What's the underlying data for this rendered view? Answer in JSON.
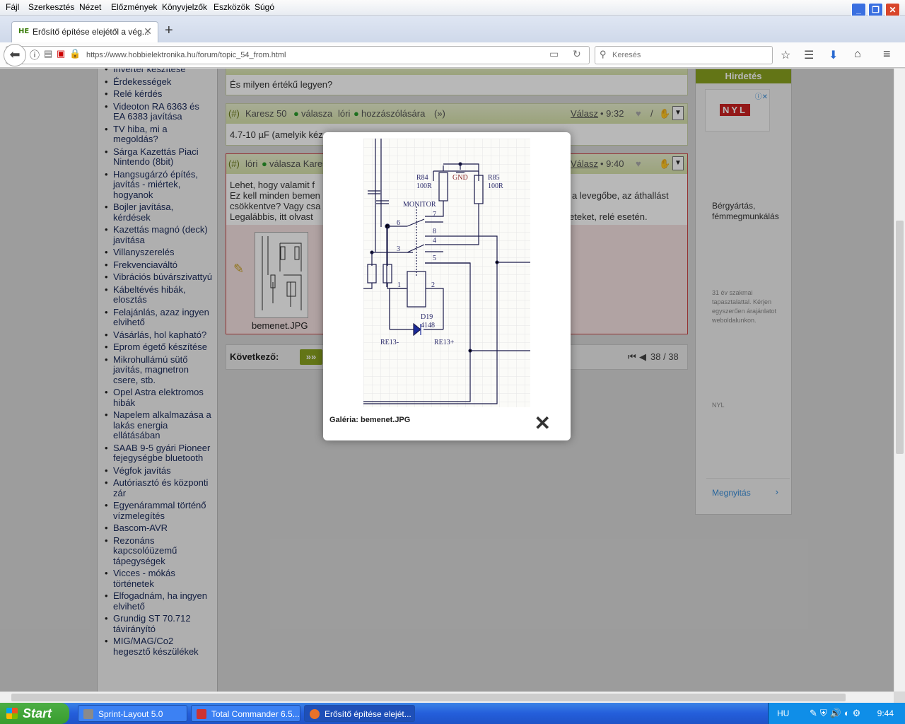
{
  "menu": [
    "Fájl",
    "Szerkesztés",
    "Nézet",
    "Előzmények",
    "Könyvjelzők",
    "Eszközök",
    "Súgó"
  ],
  "tab": {
    "favicon": "HE",
    "title": "Erősítő építése elejétől a vég...",
    "close": "✕",
    "new": "+"
  },
  "nav": {
    "url": "https://www.hobbielektronika.hu/forum/topic_54_from.html",
    "search_placeholder": "Keresés"
  },
  "sidebar": {
    "items": [
      "Inverter készítése",
      "Érdekességek",
      "Relé kérdés",
      "Videoton RA 6363 és EA 6383 javítása",
      "TV hiba, mi a megoldás?",
      "Sárga Kazettás Piaci Nintendo (8bit)",
      "Hangsugárzó építés, javítás - miértek, hogyanok",
      "Bojler javítása, kérdések",
      "Kazettás magnó (deck) javítása",
      "Villanyszerelés",
      "Frekvenciaváltó",
      "Vibrációs búvárszivattyú",
      "Kábeltévés hibák, elosztás",
      "Felajánlás, azaz ingyen elvihető",
      "Vásárlás, hol kapható?",
      "Eprom égető készítése",
      "Mikrohullámú sütő javítás, magnetron csere, stb.",
      "Opel Astra elektromos hibák",
      "Napelem alkalmazása a lakás energia ellátásában",
      "SAAB 9-5 gyári Pioneer fejegységbe bluetooth",
      "Végfok javítás",
      "Autóriasztó és központi zár",
      "Egyenárammal történő vízmelegítés",
      "Bascom-AVR",
      "Rezonáns kapcsolóüzemű tápegységek",
      "Vicces - mókás történetek",
      "Elfogadnám, ha ingyen elvihető",
      "Grundig ST 70.712 távirányító",
      "MIG/MAG/Co2 hegesztő készülékek"
    ]
  },
  "posts": {
    "p1_body": "És milyen értékű legyen?",
    "p2": {
      "hash": "(#)",
      "author": "Karesz 50",
      "reply_to": "válasza",
      "target": "lóri",
      "suffix": "hozzászólására",
      "link": "(»)",
      "reply": "Válasz",
      "time": "• 9:32",
      "sep": "/",
      "body": "4.7-10 µF (amelyik kéz"
    },
    "p3": {
      "hash": "(#)",
      "author": "lóri",
      "reply_to": "válasza Karesz",
      "reply": "Válasz",
      "time": "• 9:40",
      "body1": "Lehet, hogy valamit f",
      "body2": "Ez kell minden bemen",
      "body2r": "a levegőbe, az áthallást",
      "body3": "csökkentve? Vagy csa",
      "body4": "Legalábbis, itt olvast",
      "body4r": "eteket, relé esetén.",
      "attachment": "bemenet.JPG"
    },
    "next_label": "Következő:",
    "next_btn": "»»",
    "pager": "38 / 38"
  },
  "ad": {
    "header": "Hirdetés",
    "logo": "NYL",
    "line1": "Bérgyártás, fémmegmunkálás",
    "small": "31 év szakmai tapasztalattal. Kérjen egyszerűen árajánlatot weboldalunkon.",
    "brand": "NYL",
    "open": "Megnyitás"
  },
  "modal": {
    "caption": "Galéria: bemenet.JPG",
    "close": "✕",
    "labels": {
      "r84": "R84",
      "r84v": "100R",
      "r85": "R85",
      "r85v": "100R",
      "gnd": "GND",
      "monitor": "MONITOR",
      "p7": "7",
      "p6": "6",
      "p8": "8",
      "p4": "4",
      "p3": "3",
      "p5": "5",
      "p1": "1",
      "p2": "2",
      "d19": "D19",
      "d19v": "4148",
      "re_minus": "RE13-",
      "re_plus": "RE13+"
    }
  },
  "taskbar": {
    "start": "Start",
    "items": [
      "Sprint-Layout 5.0",
      "Total Commander 6.5...",
      "Erősítő építése elejét..."
    ],
    "lang": "HU",
    "clock": "9:44"
  },
  "colors": {
    "titlebar": "#245edb",
    "forum_green": "#8aa21f",
    "post_head": "#d7e2ab"
  }
}
